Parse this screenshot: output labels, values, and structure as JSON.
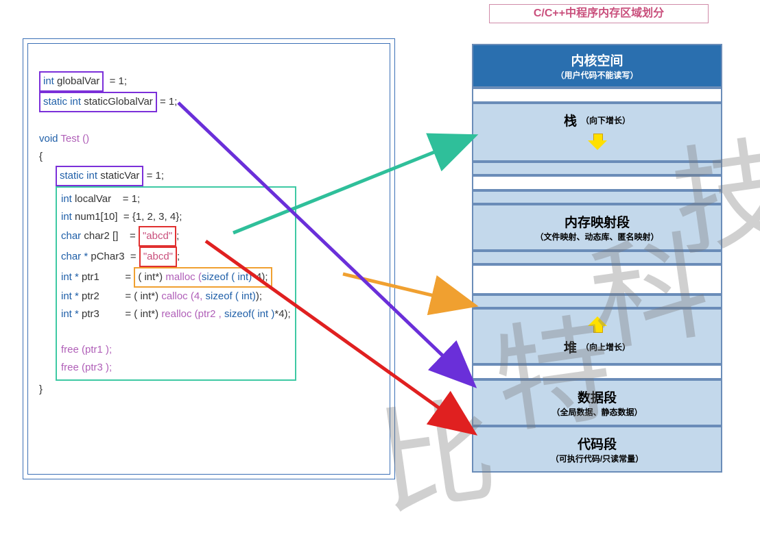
{
  "title": "C/C++中程序内存区域划分",
  "code": {
    "l1a": "int ",
    "l1b": "globalVar",
    "l1c": "  = 1;",
    "l2a": "static int ",
    "l2b": "staticGlobalVar",
    "l2c": " = 1;",
    "l3a": "void ",
    "l3b": "Test ()",
    "l4": "{",
    "l5a": "static int ",
    "l5b": "staticVar",
    "l5c": " = 1;",
    "l6a": "int ",
    "l6b": "localVar    = 1;",
    "l7a": "int ",
    "l7b": "num1[10]  = {1, 2, 3, 4};",
    "l8a": "char ",
    "l8b": "char2 []    = ",
    "l8c": "\"abcd\"",
    "l8d": ";",
    "l9a": "char * ",
    "l9b": "pChar3  = ",
    "l9c": "\"abcd\"",
    "l9d": ";",
    "l10a": "int * ",
    "l10b": "ptr1         = ",
    "l10c": "( int*) ",
    "l10d": "malloc (",
    "l10e": "sizeof ( int)",
    "l10f": "*4);",
    "l11a": "int * ",
    "l11b": "ptr2         = ( int*) ",
    "l11c": "calloc (4, ",
    "l11d": "sizeof ( int)",
    "l11e": ");",
    "l12a": "int * ",
    "l12b": "ptr3         = ( int*) ",
    "l12c": "realloc (ptr2 , ",
    "l12d": "sizeof( int )",
    "l12e": "*4);",
    "l13": "free (ptr1 );",
    "l14": "free (ptr3 );",
    "l15": "}"
  },
  "memory": {
    "kernel_title": "内核空间",
    "kernel_sub": "（用户代码不能读写）",
    "stack_title": "栈",
    "stack_sub": "（向下增长）",
    "mmap_title": "内存映射段",
    "mmap_sub": "（文件映射、动态库、匿名映射）",
    "heap_title": "堆",
    "heap_sub": "（向上增长）",
    "data_title": "数据段",
    "data_sub": "（全局数据、静态数据）",
    "code_title": "代码段",
    "code_sub": "（可执行代码/只读常量）"
  },
  "watermark": {
    "c1": "比",
    "c2": "特",
    "c3": "科",
    "c4": "技"
  },
  "arrows": {
    "green": {
      "from": "stack-local-vars",
      "to": "stack-segment",
      "color": "#2fbf9a"
    },
    "orange": {
      "from": "malloc-calls",
      "to": "heap-segment",
      "color": "#f0a030"
    },
    "purple": {
      "from": "static-vars",
      "to": "data-segment",
      "color": "#6a2fd9"
    },
    "red": {
      "from": "string-literal",
      "to": "code-segment",
      "color": "#e02020"
    }
  }
}
